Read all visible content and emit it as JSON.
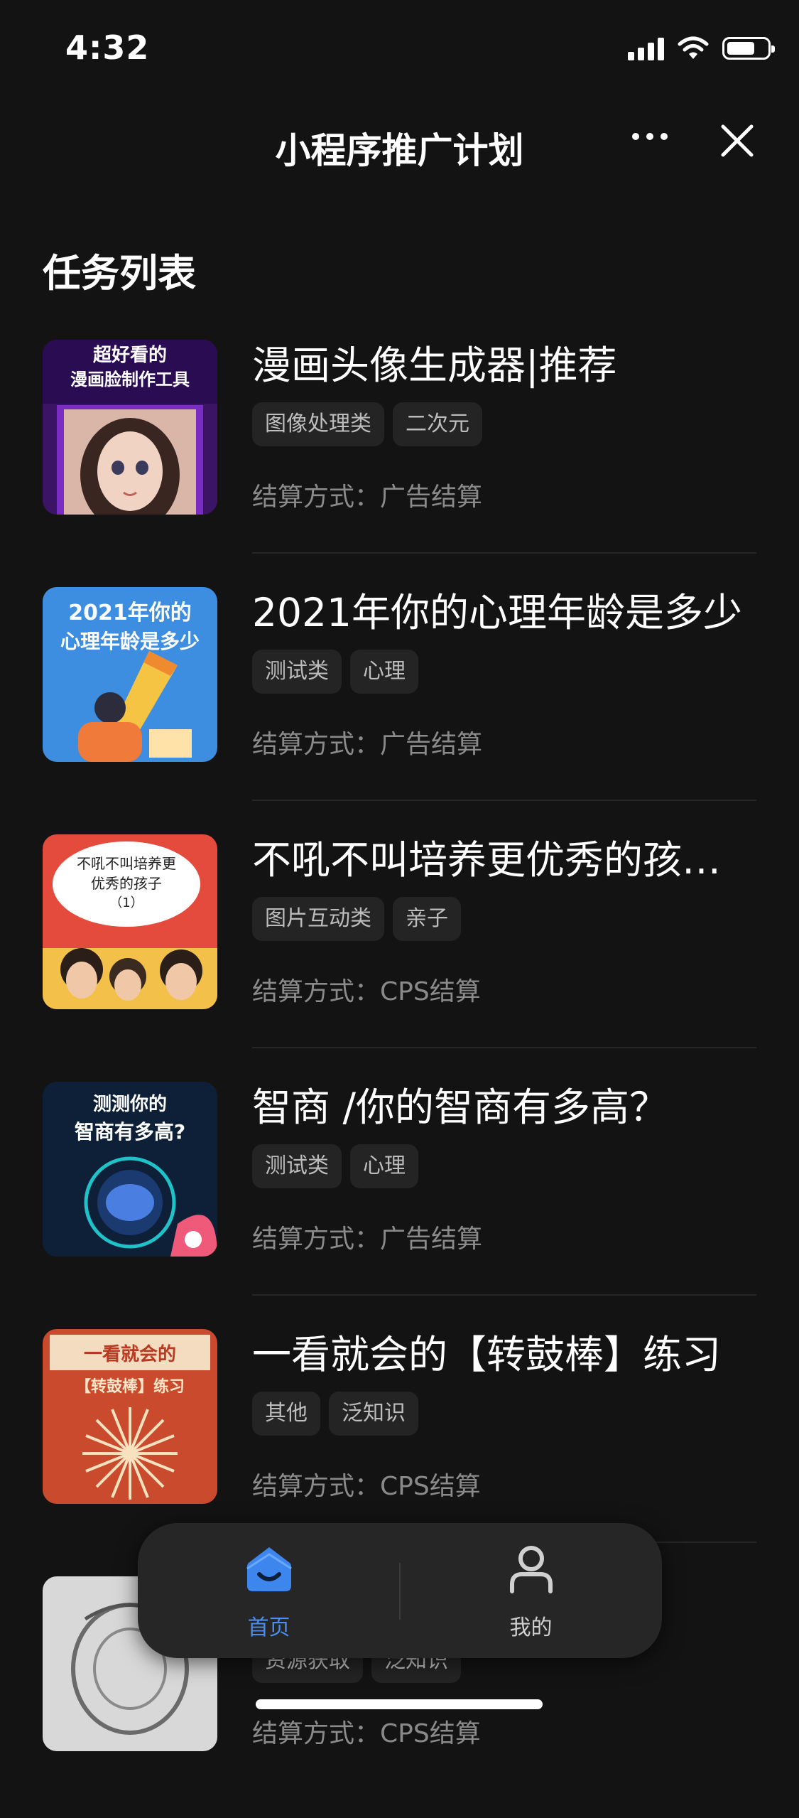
{
  "status_bar": {
    "time": "4:32",
    "battery_level": 0.75
  },
  "nav": {
    "title": "小程序推广计划",
    "more_icon": "ellipsis-icon",
    "close_icon": "close-icon"
  },
  "section_title": "任务列表",
  "tasks": [
    {
      "title": "漫画头像生成器|推荐",
      "tags": [
        "图像处理类",
        "二次元"
      ],
      "settlement": "结算方式：广告结算",
      "thumb_text": [
        "超好看的",
        "漫画脸制作工具"
      ]
    },
    {
      "title": "2021年你的心理年龄是多少",
      "tags": [
        "测试类",
        "心理"
      ],
      "settlement": "结算方式：广告结算",
      "thumb_text": [
        "2021年你的",
        "心理年龄是多少"
      ]
    },
    {
      "title": "不吼不叫培养更优秀的孩子…",
      "tags": [
        "图片互动类",
        "亲子"
      ],
      "settlement": "结算方式：CPS结算",
      "thumb_text": [
        "不吼不叫培养更",
        "优秀的孩子",
        "（1）"
      ]
    },
    {
      "title": "智商 /你的智商有多高？",
      "tags": [
        "测试类",
        "心理"
      ],
      "settlement": "结算方式：广告结算",
      "thumb_text": [
        "测测你的",
        "智商有多高?"
      ]
    },
    {
      "title": "一看就会的【转鼓棒】练习",
      "tags": [
        "其他",
        "泛知识"
      ],
      "settlement": "结算方式：CPS结算",
      "thumb_text": [
        "一看就会的",
        "【转鼓棒】练习"
      ]
    },
    {
      "title": "",
      "tags": [
        "资源获取",
        "泛知识"
      ],
      "settlement": "结算方式：CPS结算",
      "thumb_text": []
    }
  ],
  "tabbar": {
    "home": {
      "label": "首页",
      "icon": "home-icon"
    },
    "mine": {
      "label": "我的",
      "icon": "user-icon"
    }
  },
  "colors": {
    "background": "#131313",
    "accent": "#4a8ef0",
    "tag_bg": "#242424"
  }
}
